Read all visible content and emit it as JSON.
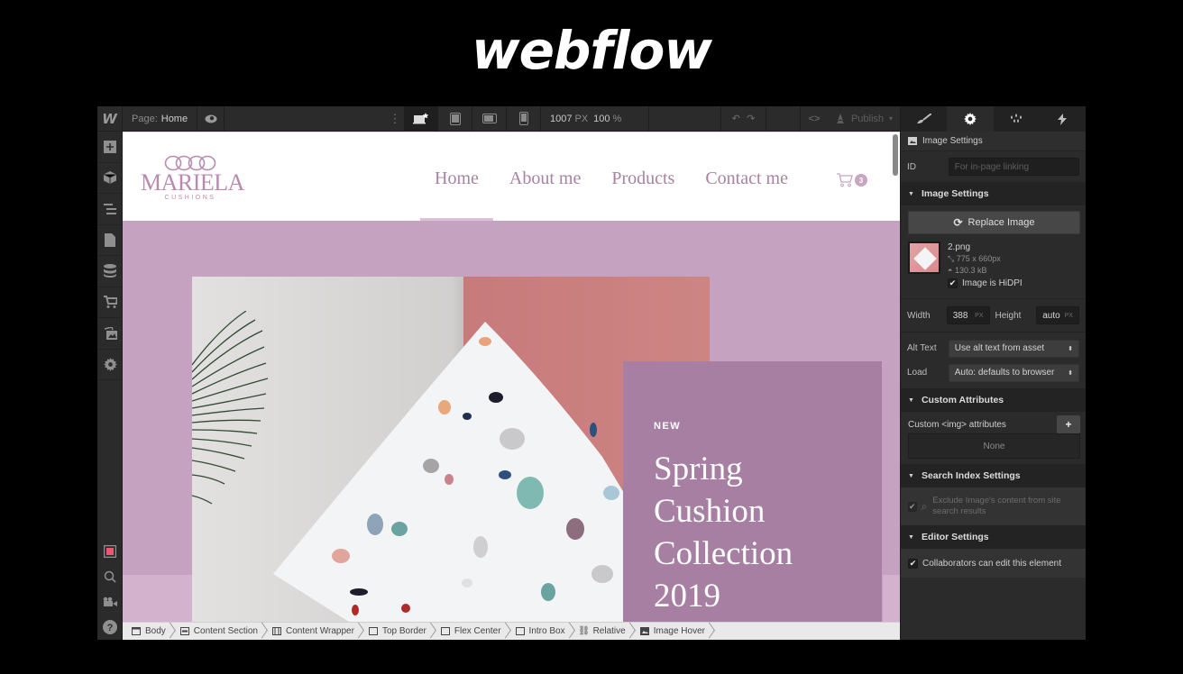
{
  "brand": "webflow",
  "topbar": {
    "logo": "W",
    "page_label": "Page:",
    "page_name": "Home",
    "canvas_width": "1007",
    "width_unit": "PX",
    "zoom": "100",
    "zoom_unit": "%",
    "publish_label": "Publish"
  },
  "left_sidebar": {
    "items": [
      "add-panel",
      "symbols",
      "navigator",
      "pages",
      "cms",
      "ecommerce",
      "assets",
      "settings"
    ],
    "bottom_items": [
      "preview-mode",
      "search",
      "video-tutorials",
      "help"
    ]
  },
  "site": {
    "logo_name": "MARIELA",
    "logo_sub": "CUSHIONS",
    "nav": [
      "Home",
      "About me",
      "Products",
      "Contact me"
    ],
    "active_nav": "Home",
    "cart_count": "3",
    "intro_tag": "NEW",
    "intro_title_lines": [
      "Spring",
      "Cushion",
      "Collection",
      "2019"
    ],
    "colors": {
      "accent": "#a882a0",
      "hero_bg": "#c4a2c0",
      "intro_box": "#a67fa2",
      "photo_pink": "#c87a7b"
    }
  },
  "breadcrumb": [
    {
      "label": "Body",
      "icon": "body-icon"
    },
    {
      "label": "Content Section",
      "icon": "section-icon"
    },
    {
      "label": "Content Wrapper",
      "icon": "container-icon"
    },
    {
      "label": "Top Border",
      "icon": "div-block-icon"
    },
    {
      "label": "Flex Center",
      "icon": "div-block-icon"
    },
    {
      "label": "Intro Box",
      "icon": "div-block-icon"
    },
    {
      "label": "Relative",
      "icon": "link-block-icon"
    },
    {
      "label": "Image Hover",
      "icon": "image-icon"
    }
  ],
  "panel": {
    "tabs": [
      "style",
      "settings",
      "interactions-drops",
      "interactions"
    ],
    "active_tab": "settings",
    "header": "Image Settings",
    "id_label": "ID",
    "id_placeholder": "For in-page linking",
    "image_section": "Image Settings",
    "replace_label": "Replace Image",
    "file_name": "2.png",
    "dimensions": "775 x 660px",
    "file_size": "130.3 kB",
    "hidpi_label": "Image is HiDPI",
    "hidpi_checked": true,
    "width_label": "Width",
    "width_value": "388",
    "width_unit": "PX",
    "height_label": "Height",
    "height_value": "auto",
    "height_unit": "PX",
    "alt_label": "Alt Text",
    "alt_value": "Use alt text from asset",
    "load_label": "Load",
    "load_value": "Auto: defaults to browser",
    "custom_section": "Custom Attributes",
    "custom_label": "Custom <img> attributes",
    "custom_add": "+",
    "custom_none": "None",
    "search_section": "Search Index Settings",
    "search_exclude": "Exclude Image's content from site search results",
    "editor_section": "Editor Settings",
    "editor_label": "Collaborators can edit this element",
    "editor_checked": true
  }
}
